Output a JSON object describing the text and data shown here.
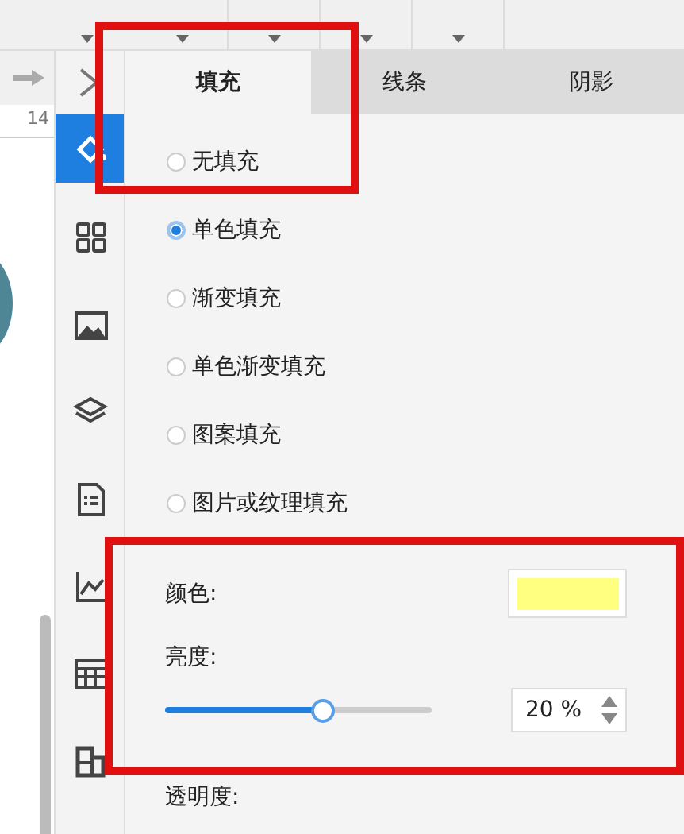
{
  "ruler": {
    "mark": "14"
  },
  "sidebar": {
    "items": [
      {
        "kind": "bucket",
        "selected": true
      },
      {
        "kind": "grid",
        "selected": false
      },
      {
        "kind": "image",
        "selected": false
      },
      {
        "kind": "layers",
        "selected": false
      },
      {
        "kind": "list",
        "selected": false
      },
      {
        "kind": "chart",
        "selected": false
      },
      {
        "kind": "table",
        "selected": false
      },
      {
        "kind": "puzzle",
        "selected": false
      }
    ]
  },
  "tabs": [
    {
      "label": "填充",
      "selected": true
    },
    {
      "label": "线条",
      "selected": false
    },
    {
      "label": "阴影",
      "selected": false
    }
  ],
  "fill_options": [
    {
      "label": "无填充",
      "selected": false
    },
    {
      "label": "单色填充",
      "selected": true
    },
    {
      "label": "渐变填充",
      "selected": false
    },
    {
      "label": "单色渐变填充",
      "selected": false
    },
    {
      "label": "图案填充",
      "selected": false
    },
    {
      "label": "图片或纹理填充",
      "selected": false
    }
  ],
  "color_field": {
    "label": "颜色:",
    "swatch": {
      "color": "#ffff80"
    }
  },
  "brightness": {
    "label": "亮度:",
    "level": 0.59,
    "value": "20 %"
  },
  "transparency": {
    "label": "透明度:"
  }
}
